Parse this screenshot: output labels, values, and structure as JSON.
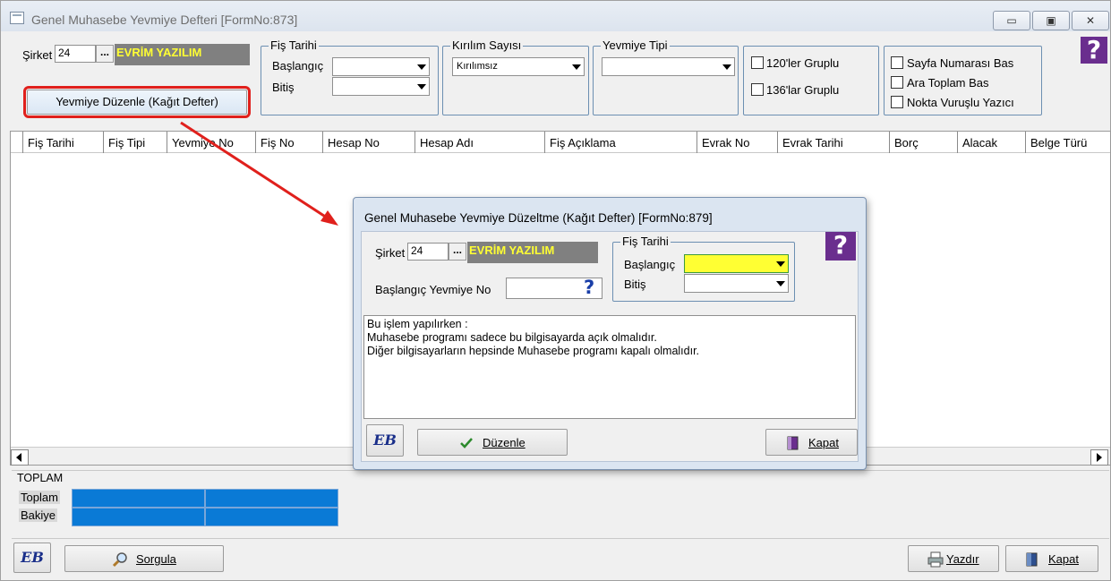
{
  "main": {
    "title": "Genel Muhasebe Yevmiye Defteri [FormNo:873]",
    "window_buttons": {
      "minimize": "▭",
      "maximize": "▣",
      "close": "✕"
    },
    "sirket_label": "Şirket",
    "sirket_code": "24",
    "sirket_dots": "...",
    "company_name": "EVRİM YAZILIM",
    "duzenle_button": "Yevmiye Düzenle (Kağıt Defter)",
    "fis_tarihi": {
      "group_label": "Fiş Tarihi",
      "start_label": "Başlangıç",
      "end_label": "Bitiş",
      "start_value": "",
      "end_value": ""
    },
    "kirilim": {
      "group_label": "Kırılım Sayısı",
      "value": "Kırılımsız"
    },
    "yevmiye_tipi": {
      "group_label": "Yevmiye Tipi",
      "value": ""
    },
    "gruplu": {
      "opt120": "120'ler  Gruplu",
      "opt136": "136'lar  Gruplu"
    },
    "print_opts": {
      "sayfa": "Sayfa Numarası Bas",
      "ara": "Ara Toplam Bas",
      "nokta": "Nokta Vuruşlu Yazıcı"
    },
    "help_icon": "?",
    "columns": [
      "Fiş Tarihi",
      "Fiş Tipi",
      "Yevmiye No",
      "Fiş No",
      "Hesap No",
      "Hesap Adı",
      "Fiş Açıklama",
      "Evrak No",
      "Evrak Tarihi",
      "Borç",
      "Alacak",
      "Belge Türü"
    ],
    "totals": {
      "section_label": "TOPLAM",
      "toplam_label": "Toplam",
      "bakiye_label": "Bakiye"
    },
    "footer": {
      "sorgula": "Sorgula",
      "yazdir": "Yazdır",
      "kapat": "Kapat",
      "logo": "EB"
    }
  },
  "dialog": {
    "title": "Genel Muhasebe Yevmiye Düzeltme (Kağıt Defter) [FormNo:879]",
    "sirket_label": "Şirket",
    "sirket_code": "24",
    "sirket_dots": "...",
    "company_name": "EVRİM YAZILIM",
    "baslangic_yevmiye_label": "Başlangıç Yevmiye No",
    "baslangic_yevmiye_value": "",
    "yevmiye_help": "?",
    "fis_tarihi": {
      "group_label": "Fiş Tarihi",
      "start_label": "Başlangıç",
      "end_label": "Bitiş"
    },
    "help_icon": "?",
    "memo_lines": [
      "Bu işlem yapılırken :",
      "Muhasebe programı sadece bu bilgisayarda açık olmalıdır.",
      "Diğer bilgisayarların hepsinde Muhasebe programı kapalı olmalıdır."
    ],
    "duzenle_button": "Düzenle",
    "kapat_button": "Kapat",
    "logo": "EB"
  },
  "colors": {
    "highlight_border": "#e0201c",
    "company_bg": "#808080",
    "company_fg": "#ffff33",
    "totals_blue": "#0a7ad6",
    "active_field": "#ffff33"
  }
}
